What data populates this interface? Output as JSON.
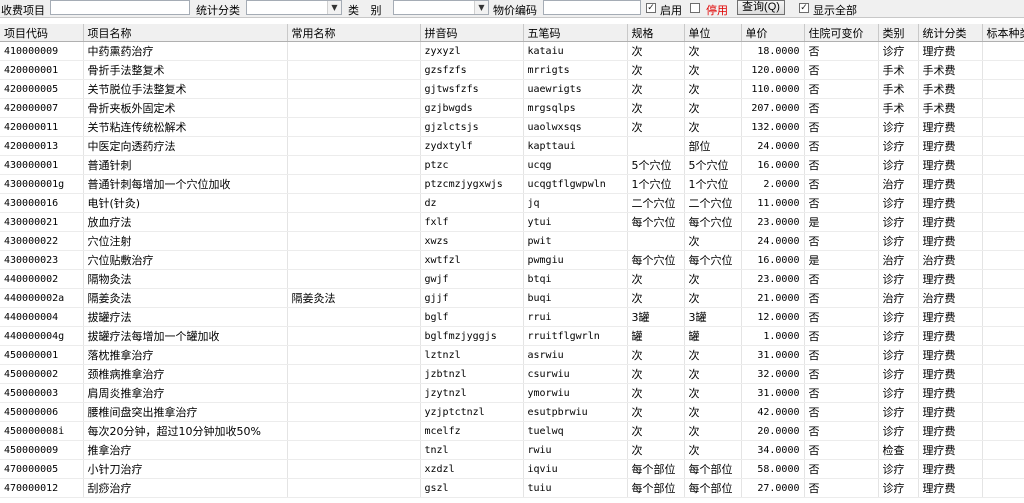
{
  "filter": {
    "fee_item_label": "收费项目",
    "fee_item_value": "",
    "stat_category_label": "统计分类",
    "stat_category_value": "",
    "category_label": "类 别",
    "category_value": "",
    "price_code_label": "物价编码",
    "price_code_value": "",
    "enable_label": "启用",
    "enable_checked": true,
    "disable_label": "停用",
    "disable_checked": false,
    "query_label": "查询(Q)",
    "show_all_label": "显示全部",
    "show_all_checked": true,
    "disable_color": "#e00000"
  },
  "table": {
    "columns": [
      "项目代码",
      "项目名称",
      "常用名称",
      "拼音码",
      "五笔码",
      "规格",
      "单位",
      "单价",
      "住院可变价",
      "类别",
      "统计分类",
      "标本种类"
    ],
    "rows": [
      [
        "410000009",
        "中药熏药治疗",
        "",
        "zyxyzl",
        "kataiu",
        "次",
        "次",
        "18.0000",
        "否",
        "诊疗",
        "理疗费",
        ""
      ],
      [
        "420000001",
        "骨折手法整复术",
        "",
        "gzsfzfs",
        "mrrigts",
        "次",
        "次",
        "120.0000",
        "否",
        "手术",
        "手术费",
        ""
      ],
      [
        "420000005",
        "关节脱位手法整复术",
        "",
        "gjtwsfzfs",
        "uaewrigts",
        "次",
        "次",
        "110.0000",
        "否",
        "手术",
        "手术费",
        ""
      ],
      [
        "420000007",
        "骨折夹板外固定术",
        "",
        "gzjbwgds",
        "mrgsqlps",
        "次",
        "次",
        "207.0000",
        "否",
        "手术",
        "手术费",
        ""
      ],
      [
        "420000011",
        "关节粘连传统松解术",
        "",
        "gjzlctsjs",
        "uaolwxsqs",
        "次",
        "次",
        "132.0000",
        "否",
        "诊疗",
        "理疗费",
        ""
      ],
      [
        "420000013",
        "中医定向透药疗法",
        "",
        "zydxtylf",
        "kapttaui",
        "",
        "部位",
        "24.0000",
        "否",
        "诊疗",
        "理疗费",
        ""
      ],
      [
        "430000001",
        "普通针刺",
        "",
        "ptzc",
        "ucqg",
        "5个穴位",
        "5个穴位",
        "16.0000",
        "否",
        "诊疗",
        "理疗费",
        ""
      ],
      [
        "430000001g",
        "普通针刺每增加一个穴位加收",
        "",
        "ptzcmzjygxwjs",
        "ucqgtflgwpwln",
        "1个穴位",
        "1个穴位",
        "2.0000",
        "否",
        "治疗",
        "理疗费",
        ""
      ],
      [
        "430000016",
        "电针(针灸)",
        "",
        "dz",
        "jq",
        "二个穴位",
        "二个穴位",
        "11.0000",
        "否",
        "诊疗",
        "理疗费",
        ""
      ],
      [
        "430000021",
        "放血疗法",
        "",
        "fxlf",
        "ytui",
        "每个穴位",
        "每个穴位",
        "23.0000",
        "是",
        "诊疗",
        "理疗费",
        ""
      ],
      [
        "430000022",
        "穴位注射",
        "",
        "xwzs",
        "pwit",
        "",
        "次",
        "24.0000",
        "否",
        "诊疗",
        "理疗费",
        ""
      ],
      [
        "430000023",
        "穴位贴敷治疗",
        "",
        "xwtfzl",
        "pwmgiu",
        "每个穴位",
        "每个穴位",
        "16.0000",
        "是",
        "治疗",
        "治疗费",
        ""
      ],
      [
        "440000002",
        "隔物灸法",
        "",
        "gwjf",
        "btqi",
        "次",
        "次",
        "23.0000",
        "否",
        "诊疗",
        "理疗费",
        ""
      ],
      [
        "440000002a",
        "隔姜灸法",
        "隔姜灸法",
        "gjjf",
        "buqi",
        "次",
        "次",
        "21.0000",
        "否",
        "治疗",
        "治疗费",
        ""
      ],
      [
        "440000004",
        "拔罐疗法",
        "",
        "bglf",
        "rrui",
        "3罐",
        "3罐",
        "12.0000",
        "否",
        "诊疗",
        "理疗费",
        ""
      ],
      [
        "440000004g",
        "拔罐疗法每增加一个罐加收",
        "",
        "bglfmzjyggjs",
        "rruitflgwrln",
        "罐",
        "罐",
        "1.0000",
        "否",
        "诊疗",
        "理疗费",
        ""
      ],
      [
        "450000001",
        "落枕推拿治疗",
        "",
        "lztnzl",
        "asrwiu",
        "次",
        "次",
        "31.0000",
        "否",
        "诊疗",
        "理疗费",
        ""
      ],
      [
        "450000002",
        "颈椎病推拿治疗",
        "",
        "jzbtnzl",
        "csurwiu",
        "次",
        "次",
        "32.0000",
        "否",
        "诊疗",
        "理疗费",
        ""
      ],
      [
        "450000003",
        "肩周炎推拿治疗",
        "",
        "jzytnzl",
        "ymorwiu",
        "次",
        "次",
        "31.0000",
        "否",
        "诊疗",
        "理疗费",
        ""
      ],
      [
        "450000006",
        "腰椎间盘突出推拿治疗",
        "",
        "yzjptctnzl",
        "esutpbrwiu",
        "次",
        "次",
        "42.0000",
        "否",
        "诊疗",
        "理疗费",
        ""
      ],
      [
        "450000008i",
        "每次20分钟，超过10分钟加收50%",
        "",
        "mcelfz",
        "tuelwq",
        "次",
        "次",
        "20.0000",
        "否",
        "诊疗",
        "理疗费",
        ""
      ],
      [
        "450000009",
        "推拿治疗",
        "",
        "tnzl",
        "rwiu",
        "次",
        "次",
        "34.0000",
        "否",
        "检查",
        "理疗费",
        ""
      ],
      [
        "470000005",
        "小针刀治疗",
        "",
        "xzdzl",
        "iqviu",
        "每个部位",
        "每个部位",
        "58.0000",
        "否",
        "诊疗",
        "理疗费",
        ""
      ],
      [
        "470000012",
        "刮痧治疗",
        "",
        "gszl",
        "tuiu",
        "每个部位",
        "每个部位",
        "27.0000",
        "否",
        "诊疗",
        "理疗费",
        ""
      ]
    ]
  }
}
